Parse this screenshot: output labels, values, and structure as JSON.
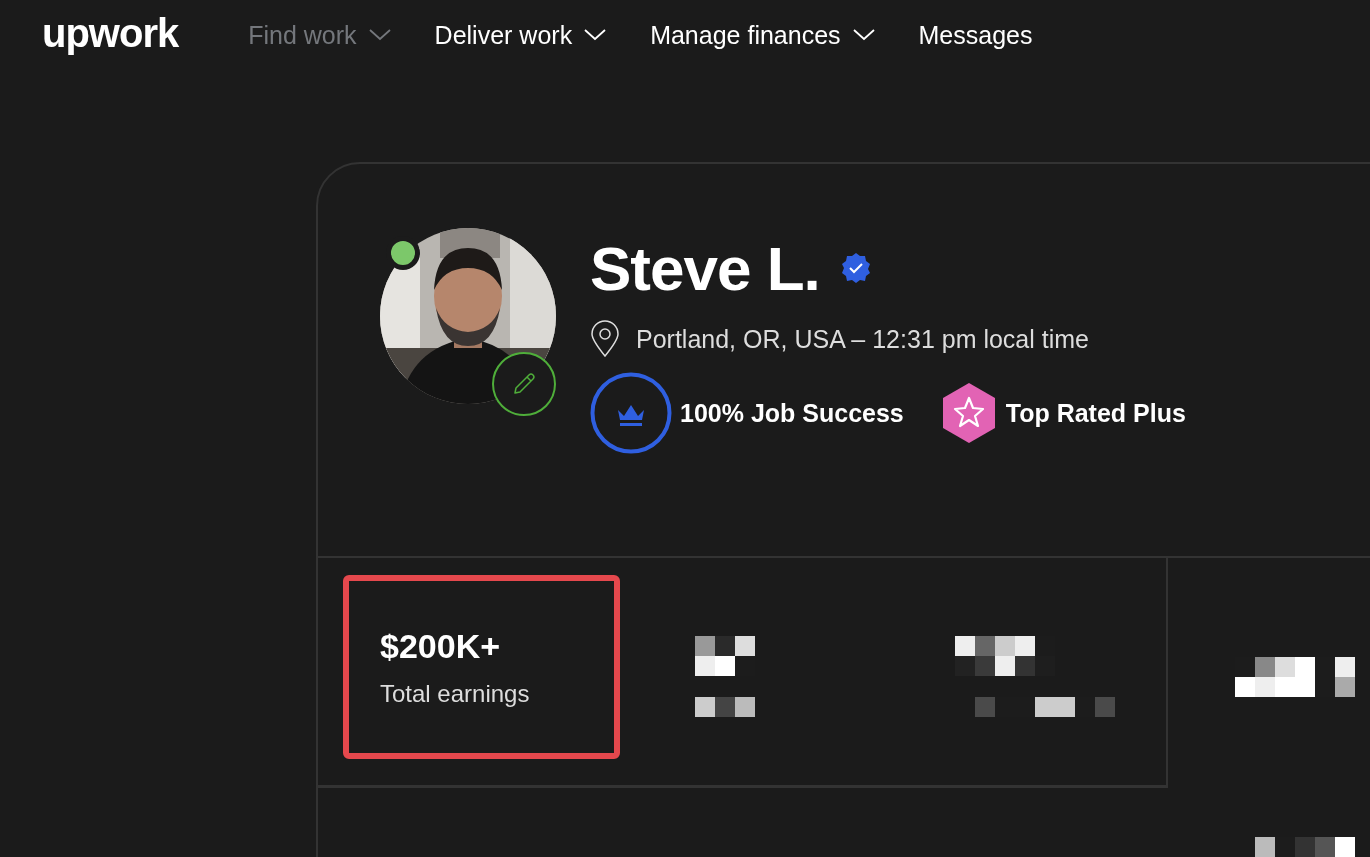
{
  "header": {
    "logo": "upwork",
    "nav": [
      {
        "label": "Find work",
        "dimmed": true,
        "dropdown": true
      },
      {
        "label": "Deliver work",
        "dimmed": false,
        "dropdown": true
      },
      {
        "label": "Manage finances",
        "dimmed": false,
        "dropdown": true
      },
      {
        "label": "Messages",
        "dimmed": false,
        "dropdown": false
      }
    ]
  },
  "profile": {
    "avatar": {
      "kind": "picture",
      "online": true,
      "editable": true
    },
    "name": "Steve L.",
    "verified": true,
    "location": "Portland, OR, USA – 12:31 pm local time",
    "badges": [
      {
        "kind": "job-success",
        "label": "100% Job Success"
      },
      {
        "kind": "top-rated-plus",
        "label": "Top Rated Plus"
      }
    ]
  },
  "stats": [
    {
      "value": "$200K+",
      "label": "Total earnings",
      "highlighted": true
    }
  ]
}
